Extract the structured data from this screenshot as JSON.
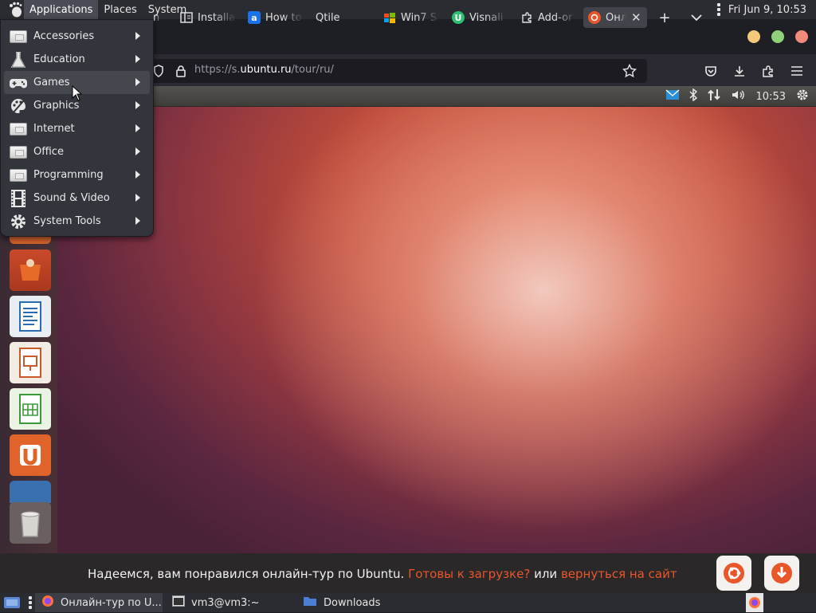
{
  "top_panel": {
    "menus": [
      {
        "label": "Applications"
      },
      {
        "label": "Places"
      },
      {
        "label": "System"
      }
    ],
    "clock": "Fri Jun  9, 10:53"
  },
  "app_menu": {
    "items": [
      {
        "label": "Accessories",
        "icon": "accessories-icon"
      },
      {
        "label": "Education",
        "icon": "flask-icon"
      },
      {
        "label": "Games",
        "icon": "gamepad-icon",
        "highlighted": true
      },
      {
        "label": "Graphics",
        "icon": "palette-icon"
      },
      {
        "label": "Internet",
        "icon": "internet-icon"
      },
      {
        "label": "Office",
        "icon": "office-icon"
      },
      {
        "label": "Programming",
        "icon": "programming-icon"
      },
      {
        "label": "Sound & Video",
        "icon": "film-icon"
      },
      {
        "label": "System Tools",
        "icon": "gear-icon"
      }
    ]
  },
  "browser": {
    "tabs": [
      {
        "label": "n",
        "favicon": "ubuntu-icon"
      },
      {
        "label": "Installa",
        "favicon": "book-icon"
      },
      {
        "label": "How to",
        "favicon": "a-icon"
      },
      {
        "label": "Qtile",
        "favicon": ""
      },
      {
        "label": "Win7 S",
        "favicon": "windows-icon"
      },
      {
        "label": "Visnali",
        "favicon": "u-icon"
      },
      {
        "label": "Add-or",
        "favicon": "puzzle-icon"
      },
      {
        "label": "Онл",
        "favicon": "ubuntu-icon",
        "selected": true
      }
    ],
    "url_prefix": "https://s.",
    "url_domain": "ubuntu.ru",
    "url_path": "/tour/ru/"
  },
  "ubuntu_panel": {
    "time": "10:53"
  },
  "tour_bar": {
    "text": "Надеемся, вам понравился онлайн-тур по Ubuntu.",
    "link_download": "Готовы к загрузке?",
    "or_text": "или",
    "link_back": "вернуться на сайт"
  },
  "taskbar": {
    "tasks": [
      {
        "label": "Онлайн-тур по U...",
        "active": true
      },
      {
        "label": "vm3@vm3:~",
        "active": false
      },
      {
        "label": "Downloads",
        "active": false
      }
    ]
  },
  "colors": {
    "accent": "#e9562a",
    "panel": "#2b2c31",
    "menu_bg": "#33353c"
  }
}
